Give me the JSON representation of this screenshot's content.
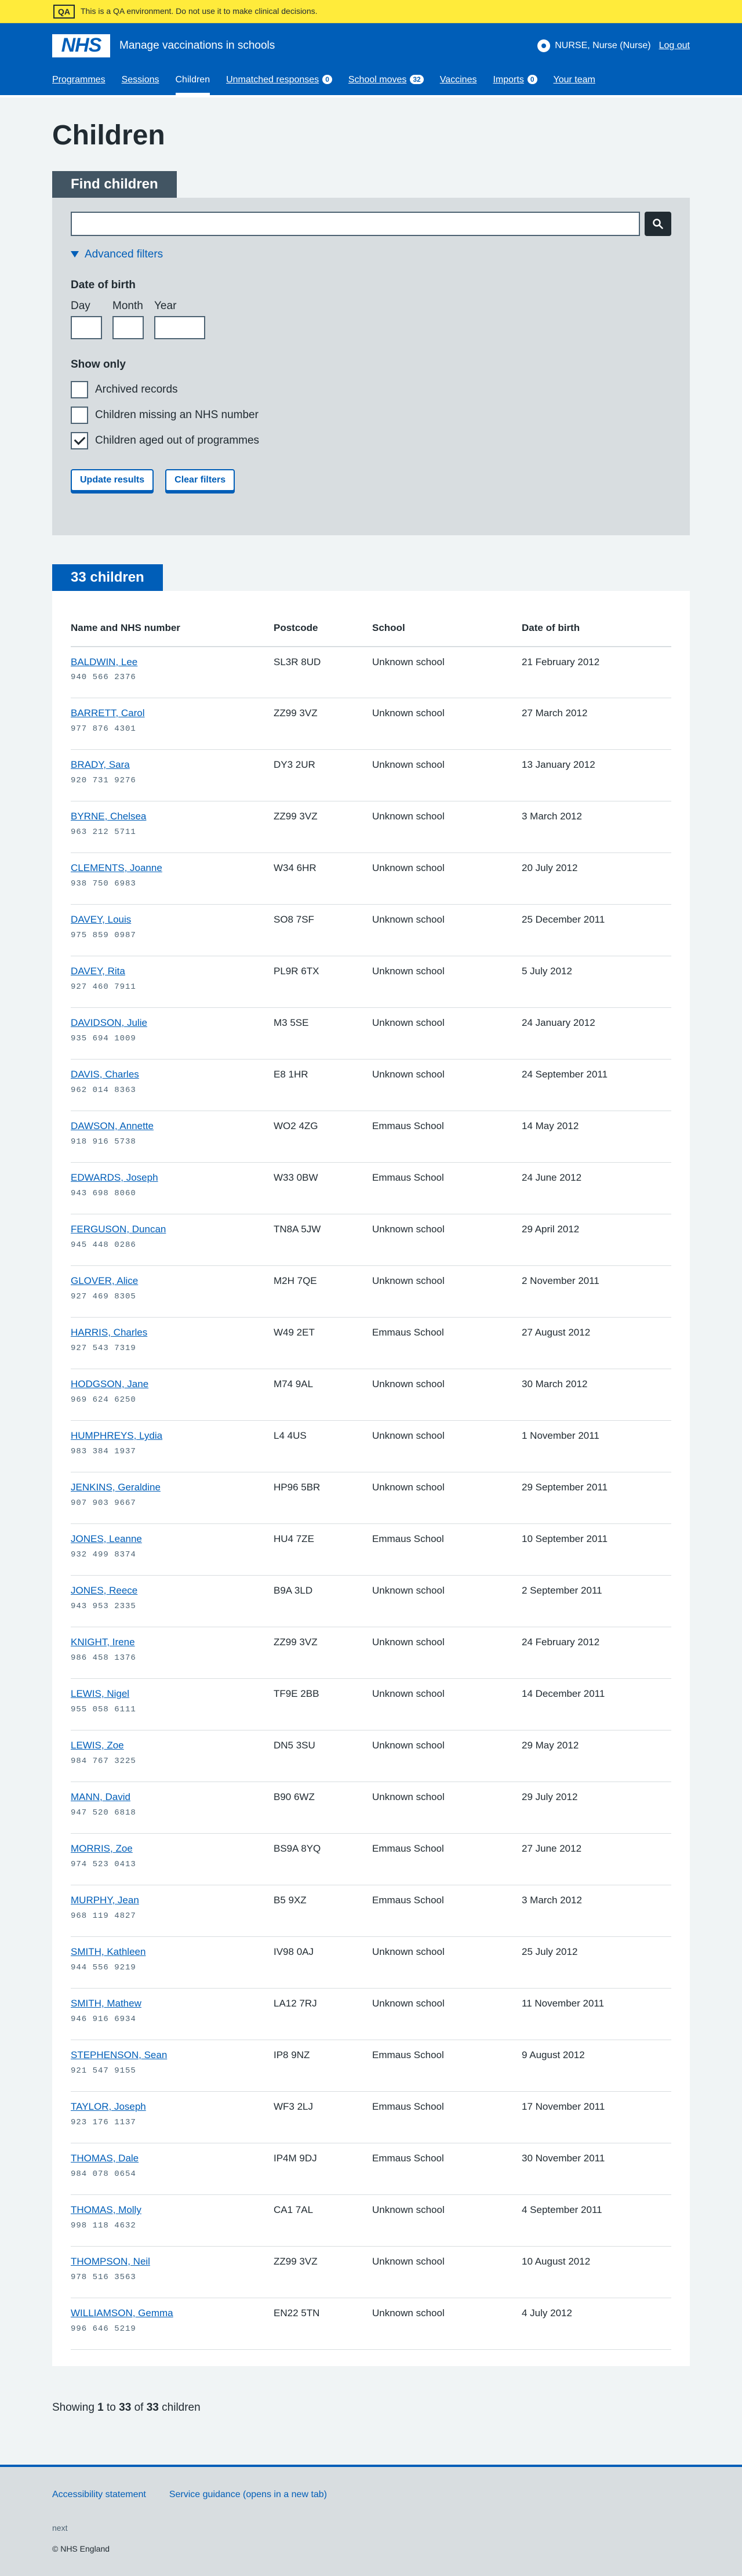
{
  "qa_banner": {
    "tag": "QA",
    "text": "This is a QA environment. Do not use it to make clinical decisions."
  },
  "header": {
    "logo": "NHS",
    "service_name": "Manage vaccinations in schools",
    "user": "NURSE, Nurse (Nurse)",
    "logout": "Log out"
  },
  "nav": [
    {
      "label": "Programmes",
      "count": ""
    },
    {
      "label": "Sessions",
      "count": ""
    },
    {
      "label": "Children",
      "count": "",
      "active": true
    },
    {
      "label": "Unmatched responses",
      "count": "0"
    },
    {
      "label": "School moves",
      "count": "32"
    },
    {
      "label": "Vaccines",
      "count": ""
    },
    {
      "label": "Imports",
      "count": "0"
    },
    {
      "label": "Your team",
      "count": ""
    }
  ],
  "page_title": "Children",
  "filters": {
    "heading": "Find children",
    "search_value": "",
    "advanced_label": "Advanced filters",
    "dob_title": "Date of birth",
    "dob_day": "Day",
    "dob_month": "Month",
    "dob_year": "Year",
    "show_only": "Show only",
    "options": [
      {
        "label": "Archived records",
        "checked": false
      },
      {
        "label": "Children missing an NHS number",
        "checked": false
      },
      {
        "label": "Children aged out of programmes",
        "checked": true
      }
    ],
    "update_button": "Update results",
    "clear_button": "Clear filters"
  },
  "results": {
    "heading": "33 children",
    "columns": [
      "Name and NHS number",
      "Postcode",
      "School",
      "Date of birth"
    ],
    "rows": [
      {
        "name": "BALDWIN, Lee",
        "nhs": "940 566 2376",
        "postcode": "SL3R 8UD",
        "school": "Unknown school",
        "dob": "21 February 2012"
      },
      {
        "name": "BARRETT, Carol",
        "nhs": "977 876 4301",
        "postcode": "ZZ99 3VZ",
        "school": "Unknown school",
        "dob": "27 March 2012"
      },
      {
        "name": "BRADY, Sara",
        "nhs": "920 731 9276",
        "postcode": "DY3 2UR",
        "school": "Unknown school",
        "dob": "13 January 2012"
      },
      {
        "name": "BYRNE, Chelsea",
        "nhs": "963 212 5711",
        "postcode": "ZZ99 3VZ",
        "school": "Unknown school",
        "dob": "3 March 2012"
      },
      {
        "name": "CLEMENTS, Joanne",
        "nhs": "938 750 6983",
        "postcode": "W34 6HR",
        "school": "Unknown school",
        "dob": "20 July 2012"
      },
      {
        "name": "DAVEY, Louis",
        "nhs": "975 859 0987",
        "postcode": "SO8 7SF",
        "school": "Unknown school",
        "dob": "25 December 2011"
      },
      {
        "name": "DAVEY, Rita",
        "nhs": "927 460 7911",
        "postcode": "PL9R 6TX",
        "school": "Unknown school",
        "dob": "5 July 2012"
      },
      {
        "name": "DAVIDSON, Julie",
        "nhs": "935 694 1009",
        "postcode": "M3 5SE",
        "school": "Unknown school",
        "dob": "24 January 2012"
      },
      {
        "name": "DAVIS, Charles",
        "nhs": "962 014 8363",
        "postcode": "E8 1HR",
        "school": "Unknown school",
        "dob": "24 September 2011"
      },
      {
        "name": "DAWSON, Annette",
        "nhs": "918 916 5738",
        "postcode": "WO2 4ZG",
        "school": "Emmaus School",
        "dob": "14 May 2012"
      },
      {
        "name": "EDWARDS, Joseph",
        "nhs": "943 698 8060",
        "postcode": "W33 0BW",
        "school": "Emmaus School",
        "dob": "24 June 2012"
      },
      {
        "name": "FERGUSON, Duncan",
        "nhs": "945 448 0286",
        "postcode": "TN8A 5JW",
        "school": "Unknown school",
        "dob": "29 April 2012"
      },
      {
        "name": "GLOVER, Alice",
        "nhs": "927 469 8305",
        "postcode": "M2H 7QE",
        "school": "Unknown school",
        "dob": "2 November 2011"
      },
      {
        "name": "HARRIS, Charles",
        "nhs": "927 543 7319",
        "postcode": "W49 2ET",
        "school": "Emmaus School",
        "dob": "27 August 2012"
      },
      {
        "name": "HODGSON, Jane",
        "nhs": "969 624 6250",
        "postcode": "M74 9AL",
        "school": "Unknown school",
        "dob": "30 March 2012"
      },
      {
        "name": "HUMPHREYS, Lydia",
        "nhs": "983 384 1937",
        "postcode": "L4 4US",
        "school": "Unknown school",
        "dob": "1 November 2011"
      },
      {
        "name": "JENKINS, Geraldine",
        "nhs": "907 903 9667",
        "postcode": "HP96 5BR",
        "school": "Unknown school",
        "dob": "29 September 2011"
      },
      {
        "name": "JONES, Leanne",
        "nhs": "932 499 8374",
        "postcode": "HU4 7ZE",
        "school": "Emmaus School",
        "dob": "10 September 2011"
      },
      {
        "name": "JONES, Reece",
        "nhs": "943 953 2335",
        "postcode": "B9A 3LD",
        "school": "Unknown school",
        "dob": "2 September 2011"
      },
      {
        "name": "KNIGHT, Irene",
        "nhs": "986 458 1376",
        "postcode": "ZZ99 3VZ",
        "school": "Unknown school",
        "dob": "24 February 2012"
      },
      {
        "name": "LEWIS, Nigel",
        "nhs": "955 058 6111",
        "postcode": "TF9E 2BB",
        "school": "Unknown school",
        "dob": "14 December 2011"
      },
      {
        "name": "LEWIS, Zoe",
        "nhs": "984 767 3225",
        "postcode": "DN5 3SU",
        "school": "Unknown school",
        "dob": "29 May 2012"
      },
      {
        "name": "MANN, David",
        "nhs": "947 520 6818",
        "postcode": "B90 6WZ",
        "school": "Unknown school",
        "dob": "29 July 2012"
      },
      {
        "name": "MORRIS, Zoe",
        "nhs": "974 523 0413",
        "postcode": "BS9A 8YQ",
        "school": "Emmaus School",
        "dob": "27 June 2012"
      },
      {
        "name": "MURPHY, Jean",
        "nhs": "968 119 4827",
        "postcode": "B5 9XZ",
        "school": "Emmaus School",
        "dob": "3 March 2012"
      },
      {
        "name": "SMITH, Kathleen",
        "nhs": "944 556 9219",
        "postcode": "IV98 0AJ",
        "school": "Unknown school",
        "dob": "25 July 2012"
      },
      {
        "name": "SMITH, Mathew",
        "nhs": "946 916 6934",
        "postcode": "LA12 7RJ",
        "school": "Unknown school",
        "dob": "11 November 2011"
      },
      {
        "name": "STEPHENSON, Sean",
        "nhs": "921 547 9155",
        "postcode": "IP8 9NZ",
        "school": "Emmaus School",
        "dob": "9 August 2012"
      },
      {
        "name": "TAYLOR, Joseph",
        "nhs": "923 176 1137",
        "postcode": "WF3 2LJ",
        "school": "Emmaus School",
        "dob": "17 November 2011"
      },
      {
        "name": "THOMAS, Dale",
        "nhs": "984 078 0654",
        "postcode": "IP4M 9DJ",
        "school": "Emmaus School",
        "dob": "30 November 2011"
      },
      {
        "name": "THOMAS, Molly",
        "nhs": "998 118 4632",
        "postcode": "CA1 7AL",
        "school": "Unknown school",
        "dob": "4 September 2011"
      },
      {
        "name": "THOMPSON, Neil",
        "nhs": "978 516 3563",
        "postcode": "ZZ99 3VZ",
        "school": "Unknown school",
        "dob": "10 August 2012"
      },
      {
        "name": "WILLIAMSON, Gemma",
        "nhs": "996 646 5219",
        "postcode": "EN22 5TN",
        "school": "Unknown school",
        "dob": "4 July 2012"
      }
    ]
  },
  "pagination": {
    "prefix": "Showing",
    "from": "1",
    "to_word": "to",
    "to": "33",
    "of_word": "of",
    "total": "33",
    "suffix": "children"
  },
  "footer": {
    "links": [
      "Accessibility statement",
      "Service guidance (opens in a new tab)"
    ],
    "next": "next",
    "copyright": "© NHS England"
  }
}
